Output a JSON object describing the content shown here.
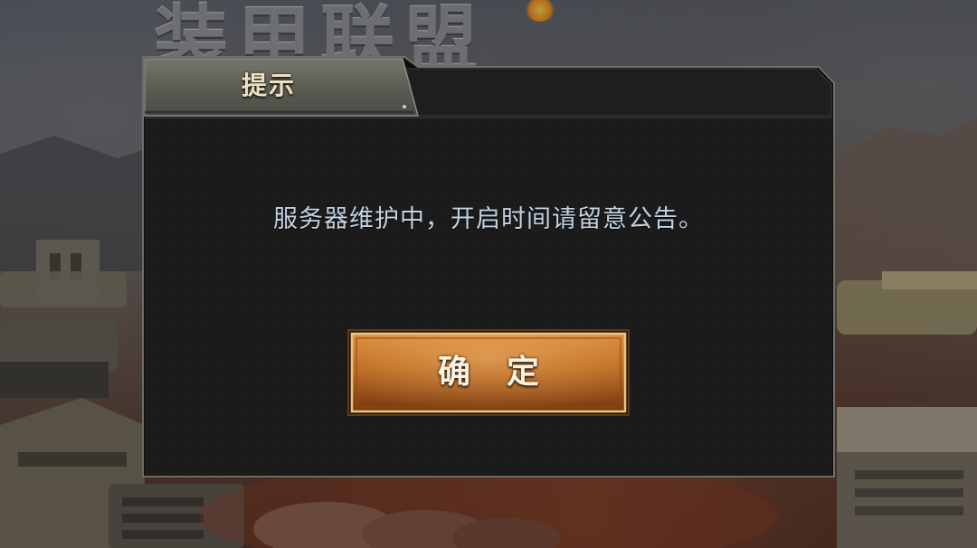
{
  "background": {
    "title_art": "装甲联盟"
  },
  "dialog": {
    "title": "提示",
    "message": "服务器维护中，开启时间请留意公告。",
    "confirm_label": "确定"
  },
  "colors": {
    "dialog_body": "#1b1b1b",
    "title_tab": "#5a5b52",
    "title_text": "#ece2c0",
    "message_text": "#c3d3e2",
    "button_orange": "#b8641c",
    "button_border": "#e8c880"
  }
}
